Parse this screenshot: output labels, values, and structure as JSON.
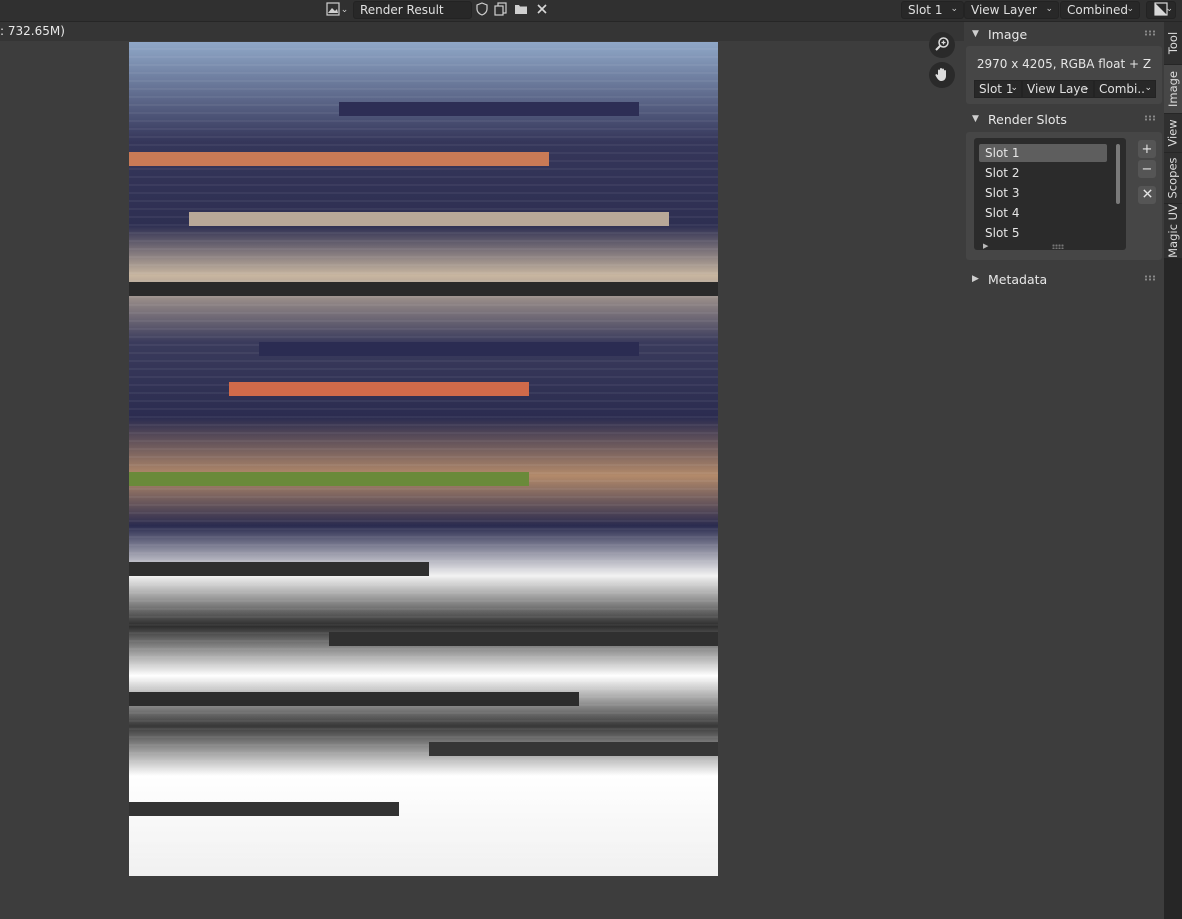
{
  "header": {
    "image_name": "Render Result",
    "slot": "Slot 1",
    "view_layer": "View Layer",
    "pass": "Combined"
  },
  "status_text": ": 732.65M)",
  "image_panel": {
    "title": "Image",
    "info": "2970 x 4205,  RGBA float + Z",
    "slot": "Slot 1",
    "view_layer": "View Laye",
    "pass": "Combi.."
  },
  "render_slots_panel": {
    "title": "Render Slots",
    "slots": [
      "Slot 1",
      "Slot 2",
      "Slot 3",
      "Slot 4",
      "Slot 5"
    ],
    "active_index": 0
  },
  "metadata_panel": {
    "title": "Metadata"
  },
  "tabs": [
    "Tool",
    "Image",
    "View",
    "Scopes",
    "Magic UV"
  ],
  "active_tab": "Image"
}
